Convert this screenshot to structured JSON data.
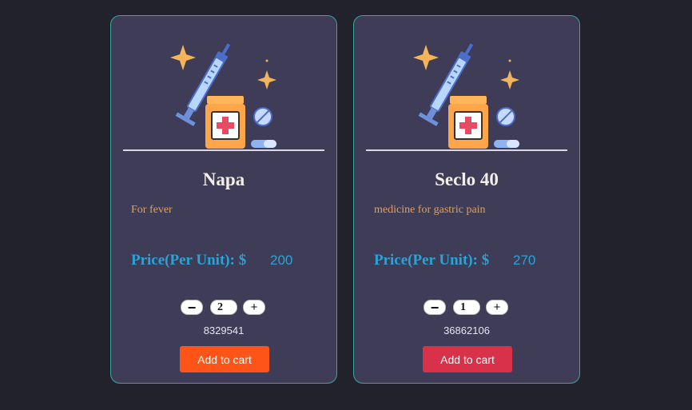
{
  "products": [
    {
      "name": "Napa",
      "description": "For fever",
      "price_label": "Price(Per Unit): $",
      "price_value": "200",
      "quantity": "2",
      "id_number": "8329541",
      "button_label": "Add to cart",
      "minus_label": "−",
      "plus_label": "+",
      "button_color": "#ff5418"
    },
    {
      "name": "Seclo 40",
      "description": "medicine for gastric pain",
      "price_label": "Price(Per Unit): $",
      "price_value": "270",
      "quantity": "1",
      "id_number": "36862106",
      "button_label": "Add to cart",
      "minus_label": "−",
      "plus_label": "+",
      "button_color": "#d9314a"
    }
  ],
  "colors": {
    "background": "#22222d",
    "card": "#3e3c57",
    "card_border": "#3aa79a",
    "price": "#2aa4d6",
    "description": "#e0a05f"
  },
  "icons": {
    "product_art": "medicine-illustration-icon"
  }
}
